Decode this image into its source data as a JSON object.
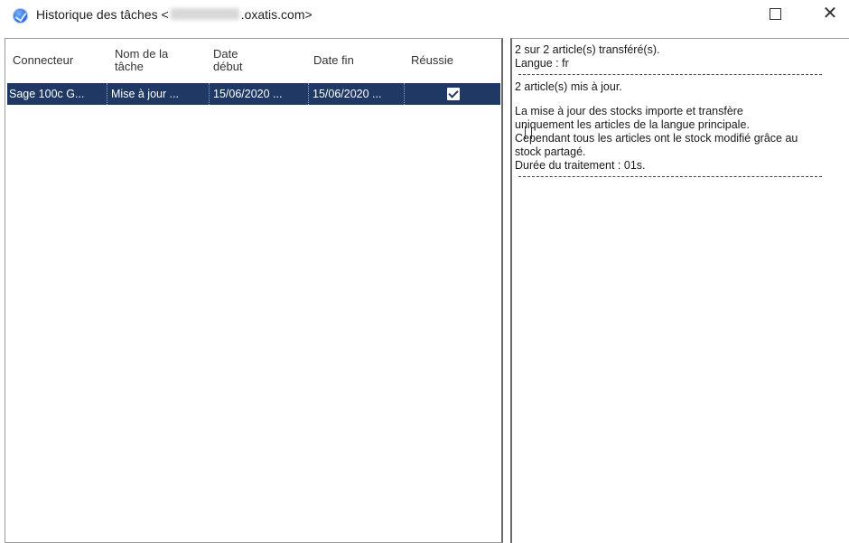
{
  "window": {
    "title_prefix": "Historique des tâches <",
    "title_suffix": ".oxatis.com>"
  },
  "table": {
    "columns": [
      "Connecteur",
      "Nom de la tâche",
      "Date début",
      "Date fin",
      "Réussie"
    ],
    "rows": [
      {
        "connecteur": "Sage 100c G...",
        "nom": "Mise à jour ...",
        "date_debut": "15/06/2020 ...",
        "date_fin": "15/06/2020 ...",
        "reussie": true
      }
    ]
  },
  "log": {
    "lines": [
      "2 sur 2 article(s) transféré(s).",
      "Langue : fr",
      "2 article(s) mis à jour.",
      "La mise à jour des stocks importe et transfère",
      "uniquement les articles de la langue principale.",
      "Cependant tous les articles ont le stock modifié grâce au",
      "stock partagé.",
      "Durée du traitement : 01s."
    ]
  }
}
